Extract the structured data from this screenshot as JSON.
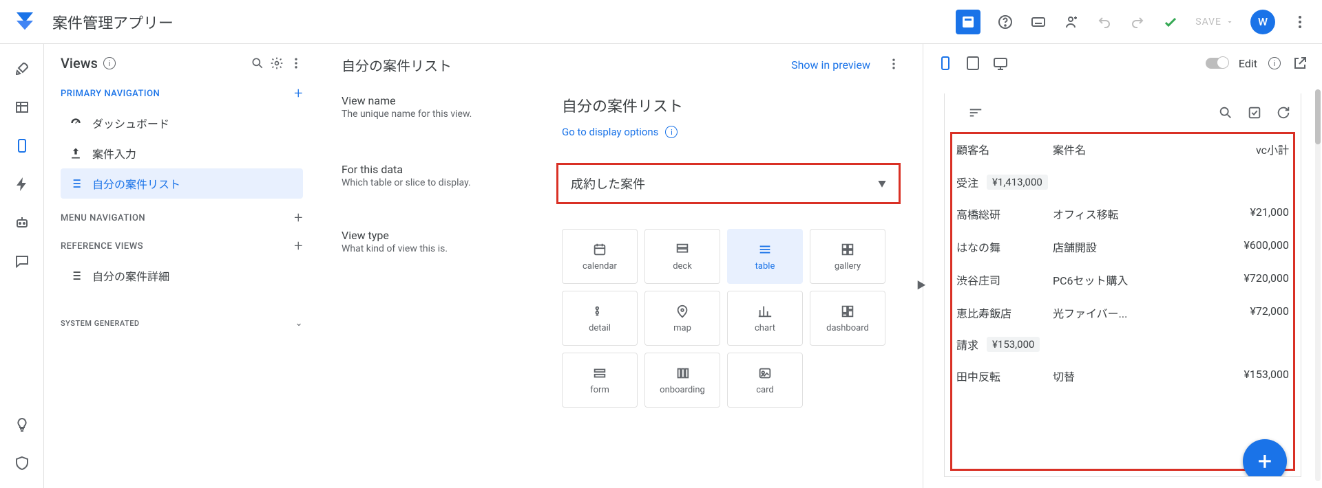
{
  "header": {
    "app_title": "案件管理アプリー",
    "save_label": "SAVE",
    "avatar_letter": "W"
  },
  "views_panel": {
    "title": "Views",
    "sections": {
      "primary_nav": "PRIMARY NAVIGATION",
      "menu_nav": "MENU NAVIGATION",
      "reference_views": "REFERENCE VIEWS",
      "system_generated": "SYSTEM GENERATED"
    },
    "items": {
      "dashboard": "ダッシュボード",
      "anken_input": "案件入力",
      "my_anken_list": "自分の案件リスト",
      "my_anken_detail": "自分の案件詳細"
    }
  },
  "center": {
    "title": "自分の案件リスト",
    "show_in_preview": "Show in preview",
    "fields": {
      "view_name": {
        "label": "View name",
        "desc": "The unique name for this view."
      },
      "for_this_data": {
        "label": "For this data",
        "desc": "Which table or slice to display."
      },
      "view_type": {
        "label": "View type",
        "desc": "What kind of view this is."
      }
    },
    "view_name_value": "自分の案件リスト",
    "go_to_display_options": "Go to display options",
    "for_this_data_value": "成約した案件",
    "view_types": {
      "calendar": "calendar",
      "deck": "deck",
      "table": "table",
      "gallery": "gallery",
      "detail": "detail",
      "map": "map",
      "chart": "chart",
      "dashboard": "dashboard",
      "form": "form",
      "onboarding": "onboarding",
      "card": "card"
    }
  },
  "right": {
    "edit_label": "Edit"
  },
  "preview": {
    "columns": {
      "c1": "顧客名",
      "c2": "案件名",
      "c3": "vc小計"
    },
    "groups": [
      {
        "label": "受注",
        "amount": "¥1,413,000"
      },
      {
        "label": "請求",
        "amount": "¥153,000"
      }
    ],
    "rows_g1": [
      {
        "c1": "高橋総研",
        "c2": "オフィス移転",
        "c3": "¥21,000"
      },
      {
        "c1": "はなの舞",
        "c2": "店舗開設",
        "c3": "¥600,000"
      },
      {
        "c1": "渋谷庄司",
        "c2": "PC6セット購入",
        "c3": "¥720,000"
      },
      {
        "c1": "恵比寿飯店",
        "c2": "光ファイバー...",
        "c3": "¥72,000"
      }
    ],
    "rows_g2": [
      {
        "c1": "田中反転",
        "c2": "切替",
        "c3": "¥153,000"
      }
    ]
  }
}
